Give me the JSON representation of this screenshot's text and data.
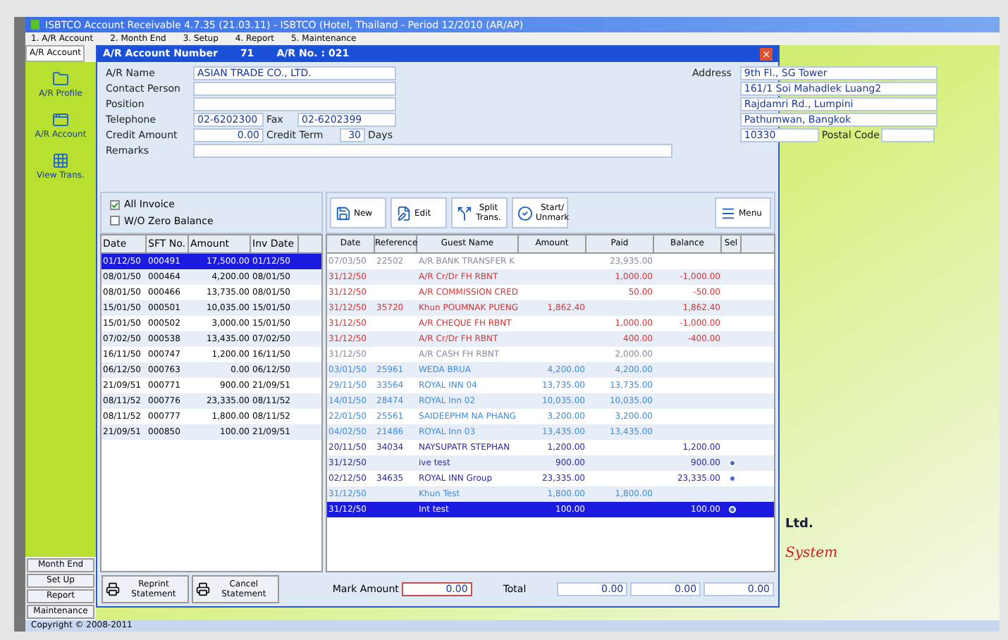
{
  "window": {
    "title": "ISBTCO Account Receivable 4.7.35 (21.03.11) - ISBTCO (Hotel, Thailand - Period 12/2010 (AR/AP)"
  },
  "menu": [
    "1. A/R Account",
    "2. Month End",
    "3. Setup",
    "4. Report",
    "5. Maintenance"
  ],
  "sidebar": {
    "tab": "A/R Account",
    "items": [
      {
        "label": "A/R Profile"
      },
      {
        "label": "A/R Account"
      },
      {
        "label": "View Trans."
      }
    ],
    "buttons": [
      "Month End",
      "Set Up",
      "Report",
      "Maintenance"
    ]
  },
  "dialog": {
    "title": "A/R Account Number",
    "number": "71",
    "ar_no": "A/R No. : 021",
    "form": {
      "name_label": "A/R Name",
      "name": "ASIAN TRADE CO., LTD.",
      "contact_label": "Contact Person",
      "position_label": "Position",
      "telephone_label": "Telephone",
      "telephone": "02-6202300",
      "fax_label": "Fax",
      "fax": "02-6202399",
      "credit_amount_label": "Credit Amount",
      "credit_amount": "0.00",
      "credit_term_label": "Credit Term",
      "credit_term": "30",
      "days_label": "Days",
      "remarks_label": "Remarks",
      "address_label": "Address",
      "address": [
        "9th Fl., SG Tower",
        "161/1 Soi Mahadlek Luang2",
        "Rajdamri Rd., Lumpini",
        "Pathumwan, Bangkok"
      ],
      "zip": "10330",
      "postal_label": "Postal Code"
    },
    "filters": [
      {
        "label": "All Invoice",
        "checked": true
      },
      {
        "label": "W/O Zero Balance",
        "checked": false
      }
    ],
    "statements": {
      "columns": [
        "Date",
        "SFT No.",
        "Amount",
        "Inv Date"
      ],
      "rows": [
        {
          "cells": [
            "01/12/50",
            "000491",
            "17,500.00",
            "01/12/50"
          ],
          "selected": true
        },
        {
          "cells": [
            "08/01/50",
            "000464",
            "4,200.00",
            "08/01/50"
          ],
          "selected": false
        },
        {
          "cells": [
            "08/01/50",
            "000466",
            "13,735.00",
            "08/01/50"
          ],
          "selected": false
        },
        {
          "cells": [
            "15/01/50",
            "000501",
            "10,035.00",
            "15/01/50"
          ],
          "selected": false
        },
        {
          "cells": [
            "15/01/50",
            "000502",
            "3,000.00",
            "15/01/50"
          ],
          "selected": false
        },
        {
          "cells": [
            "07/02/50",
            "000538",
            "13,435.00",
            "07/02/50"
          ],
          "selected": false
        },
        {
          "cells": [
            "16/11/50",
            "000747",
            "1,200.00",
            "16/11/50"
          ],
          "selected": false
        },
        {
          "cells": [
            "06/12/50",
            "000763",
            "0.00",
            "06/12/50"
          ],
          "selected": false
        },
        {
          "cells": [
            "21/09/51",
            "000771",
            "900.00",
            "21/09/51"
          ],
          "selected": false
        },
        {
          "cells": [
            "08/11/52",
            "000776",
            "23,335.00",
            "08/11/52"
          ],
          "selected": false
        },
        {
          "cells": [
            "08/11/52",
            "000777",
            "1,800.00",
            "08/11/52"
          ],
          "selected": false
        },
        {
          "cells": [
            "21/09/51",
            "000850",
            "100.00",
            "21/09/51"
          ],
          "selected": false
        }
      ]
    },
    "toolbar": [
      "New",
      "Edit",
      "Split Trans.",
      "Start/ Unmark",
      "Menu"
    ],
    "transactions": {
      "columns": [
        "Date",
        "Reference",
        "Guest Name",
        "Amount",
        "Paid",
        "Balance",
        "Sel"
      ],
      "rows": [
        {
          "kind": "void",
          "cells": [
            "07/03/50",
            "22502",
            "A/R BANK TRANSFER K",
            "",
            "23,935.00",
            ""
          ],
          "marked": false,
          "selected": false
        },
        {
          "kind": "credit",
          "cells": [
            "31/12/50",
            "",
            "A/R Cr/Dr FH RBNT",
            "",
            "1,000.00",
            "-1,000.00"
          ],
          "marked": false,
          "selected": false
        },
        {
          "kind": "credit",
          "cells": [
            "31/12/50",
            "",
            "A/R COMMISSION CRED",
            "",
            "50.00",
            "-50.00"
          ],
          "marked": false,
          "selected": false
        },
        {
          "kind": "credit",
          "cells": [
            "31/12/50",
            "35720",
            "Khun POUMNAK PUENG",
            "1,862.40",
            "",
            "1,862.40"
          ],
          "marked": false,
          "selected": false
        },
        {
          "kind": "credit",
          "cells": [
            "31/12/50",
            "",
            "A/R CHEQUE FH RBNT",
            "",
            "1,000.00",
            "-1,000.00"
          ],
          "marked": false,
          "selected": false
        },
        {
          "kind": "credit",
          "cells": [
            "31/12/50",
            "",
            "A/R Cr/Dr FH RBNT",
            "",
            "400.00",
            "-400.00"
          ],
          "marked": false,
          "selected": false
        },
        {
          "kind": "void",
          "cells": [
            "31/12/50",
            "",
            "A/R CASH FH RBNT",
            "",
            "2,000.00",
            ""
          ],
          "marked": false,
          "selected": false
        },
        {
          "kind": "paid",
          "cells": [
            "03/01/50",
            "25961",
            "WEDA BRUA",
            "4,200.00",
            "4,200.00",
            ""
          ],
          "marked": false,
          "selected": false
        },
        {
          "kind": "paid",
          "cells": [
            "29/11/50",
            "33564",
            "ROYAL INN 04",
            "13,735.00",
            "13,735.00",
            ""
          ],
          "marked": false,
          "selected": false
        },
        {
          "kind": "paid",
          "cells": [
            "14/01/50",
            "28474",
            "ROYAL Inn 02",
            "10,035.00",
            "10,035.00",
            ""
          ],
          "marked": false,
          "selected": false
        },
        {
          "kind": "paid",
          "cells": [
            "22/01/50",
            "25561",
            "SAIDEEPHM NA PHANG",
            "3,200.00",
            "3,200.00",
            ""
          ],
          "marked": false,
          "selected": false
        },
        {
          "kind": "paid",
          "cells": [
            "04/02/50",
            "21486",
            "ROYAL Inn 03",
            "13,435.00",
            "13,435.00",
            ""
          ],
          "marked": false,
          "selected": false
        },
        {
          "kind": "open",
          "cells": [
            "20/11/50",
            "34034",
            "NAYSUPATR STEPHAN",
            "1,200.00",
            "",
            "1,200.00"
          ],
          "marked": false,
          "selected": false
        },
        {
          "kind": "open",
          "cells": [
            "31/12/50",
            "",
            "ive test",
            "900.00",
            "",
            "900.00"
          ],
          "marked": true,
          "selected": false
        },
        {
          "kind": "open",
          "cells": [
            "02/12/50",
            "34635",
            "ROYAL INN Group",
            "23,335.00",
            "",
            "23,335.00"
          ],
          "marked": true,
          "selected": false
        },
        {
          "kind": "paid",
          "cells": [
            "31/12/50",
            "",
            "Khun Test",
            "1,800.00",
            "1,800.00",
            ""
          ],
          "marked": false,
          "selected": false
        },
        {
          "kind": "open",
          "cells": [
            "31/12/50",
            "",
            "Int test",
            "100.00",
            "",
            "100.00"
          ],
          "marked": true,
          "selected": true
        }
      ]
    },
    "reprint": "Reprint Statement",
    "cancel": "Cancel Statement",
    "mark_label": "Mark Amount",
    "mark_amount": "0.00",
    "total_label": "Total",
    "totals": [
      "0.00",
      "0.00",
      "0.00"
    ]
  },
  "background": {
    "company": "Ltd.",
    "tagline": "System"
  },
  "status_bar": "Copyright © 2008-2011"
}
